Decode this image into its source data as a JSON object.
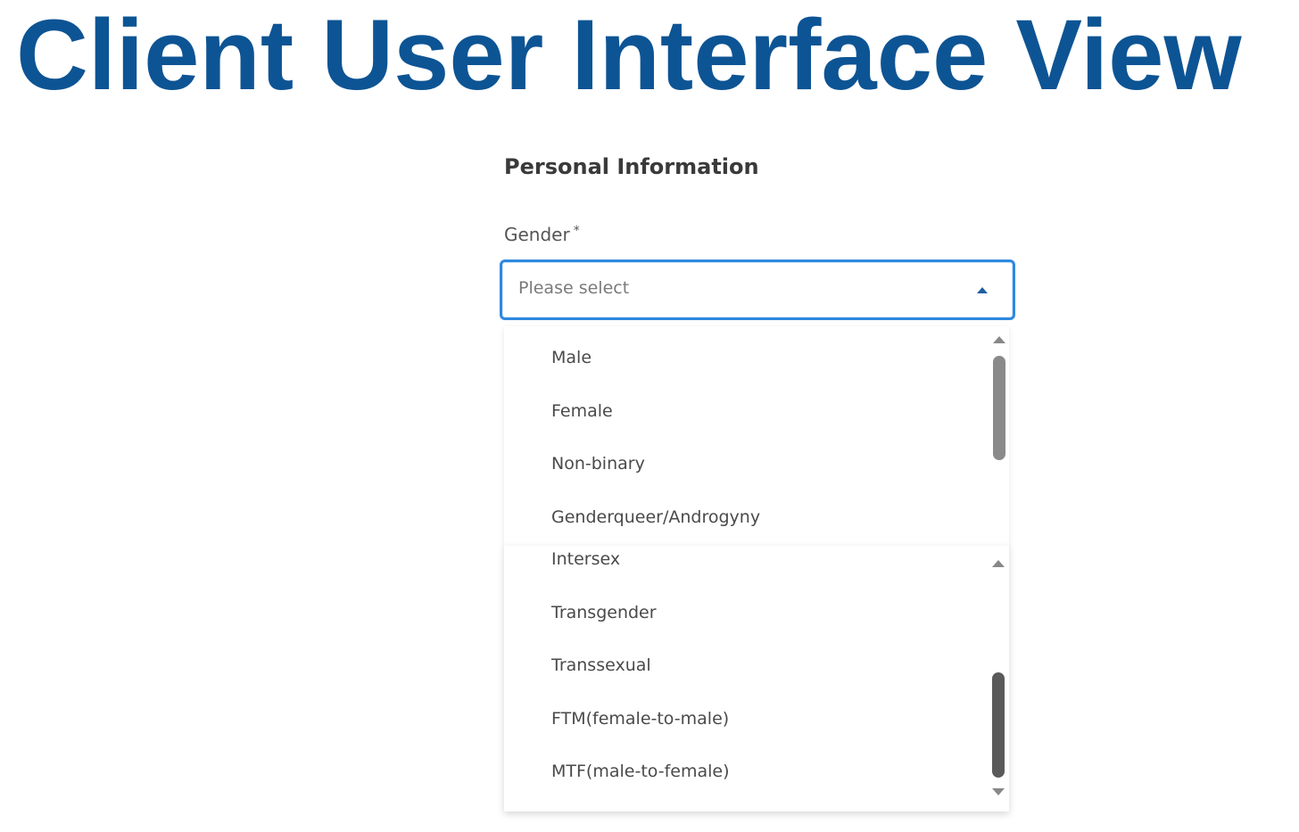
{
  "slide": {
    "title": "Client User Interface View"
  },
  "form": {
    "section_heading": "Personal Information",
    "gender_label": "Gender",
    "required_marker": "*",
    "gender_placeholder": "Please select"
  },
  "dropdown_top": {
    "options": [
      "Male",
      "Female",
      "Non-binary",
      "Genderqueer/Androgyny"
    ],
    "scroll_position": 0.0
  },
  "dropdown_bottom": {
    "options": [
      "Intersex",
      "Transgender",
      "Transsexual",
      "FTM(female-to-male)",
      "MTF(male-to-female)"
    ],
    "scroll_position": 1.0
  },
  "colors": {
    "title": "#0d5494",
    "focus_border": "#2e89e0",
    "scroll_thumb_top": "#8a8a8a",
    "scroll_thumb_bottom": "#5a5a5a"
  }
}
